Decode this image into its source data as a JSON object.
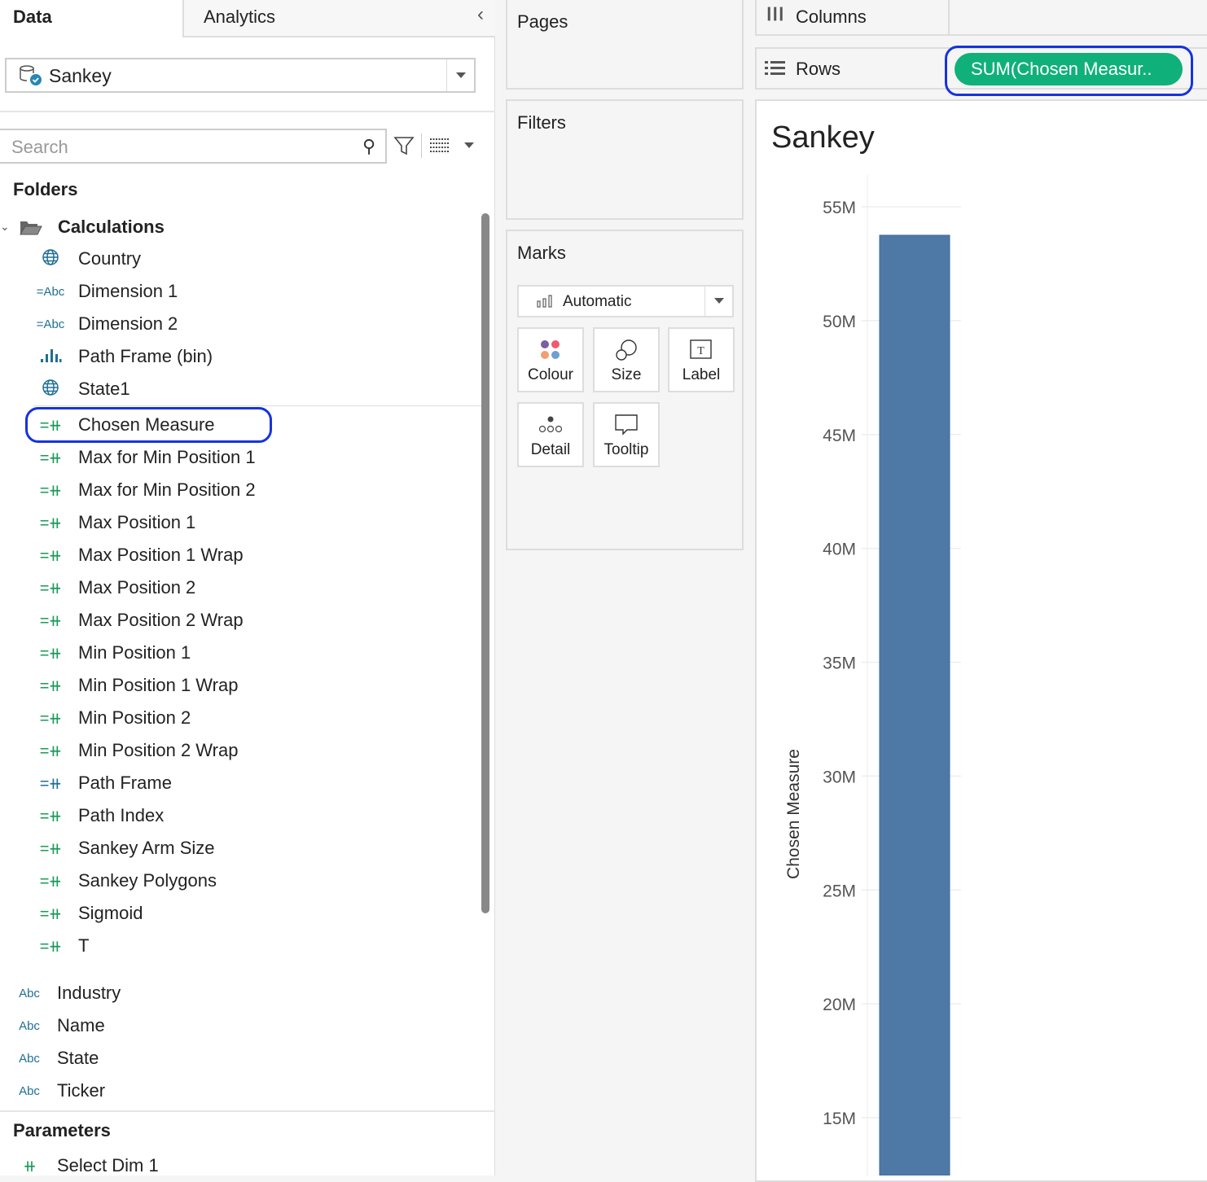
{
  "tabs": {
    "data": "Data",
    "analytics": "Analytics"
  },
  "datasource": {
    "name": "Sankey"
  },
  "search": {
    "placeholder": "Search"
  },
  "folders_header": "Folders",
  "folder": {
    "name": "Calculations"
  },
  "calc_fields": [
    {
      "label": "Country",
      "type": "geo"
    },
    {
      "label": "Dimension 1",
      "type": "calc-dim",
      "icon_text": "=Abc"
    },
    {
      "label": "Dimension 2",
      "type": "calc-dim",
      "icon_text": "=Abc"
    },
    {
      "label": "Path Frame (bin)",
      "type": "bin"
    },
    {
      "label": "State1",
      "type": "geo"
    },
    {
      "label": "Chosen Measure",
      "type": "calc-measure",
      "icon_text": "=#",
      "highlighted": true
    },
    {
      "label": "Max for Min Position 1",
      "type": "calc-measure",
      "icon_text": "=#"
    },
    {
      "label": "Max for Min Position 2",
      "type": "calc-measure",
      "icon_text": "=#"
    },
    {
      "label": "Max Position 1",
      "type": "calc-measure",
      "icon_text": "=#"
    },
    {
      "label": "Max Position 1 Wrap",
      "type": "calc-measure",
      "icon_text": "=#"
    },
    {
      "label": "Max Position 2",
      "type": "calc-measure",
      "icon_text": "=#"
    },
    {
      "label": "Max Position 2 Wrap",
      "type": "calc-measure",
      "icon_text": "=#"
    },
    {
      "label": "Min Position 1",
      "type": "calc-measure",
      "icon_text": "=#"
    },
    {
      "label": "Min Position 1 Wrap",
      "type": "calc-measure",
      "icon_text": "=#"
    },
    {
      "label": "Min Position 2",
      "type": "calc-measure",
      "icon_text": "=#"
    },
    {
      "label": "Min Position 2 Wrap",
      "type": "calc-measure",
      "icon_text": "=#"
    },
    {
      "label": "Path Frame",
      "type": "calc-dim-num",
      "icon_text": "=#"
    },
    {
      "label": "Path Index",
      "type": "calc-measure",
      "icon_text": "=#"
    },
    {
      "label": "Sankey Arm Size",
      "type": "calc-measure",
      "icon_text": "=#"
    },
    {
      "label": "Sankey Polygons",
      "type": "calc-measure",
      "icon_text": "=#"
    },
    {
      "label": "Sigmoid",
      "type": "calc-measure",
      "icon_text": "=#"
    },
    {
      "label": "T",
      "type": "calc-measure",
      "icon_text": "=#"
    }
  ],
  "dimensions": [
    {
      "label": "Industry",
      "icon_text": "Abc"
    },
    {
      "label": "Name",
      "icon_text": "Abc"
    },
    {
      "label": "State",
      "icon_text": "Abc"
    },
    {
      "label": "Ticker",
      "icon_text": "Abc"
    }
  ],
  "parameters_header": "Parameters",
  "parameters": [
    {
      "label": "Select Dim 1",
      "icon_text": "#"
    }
  ],
  "cards": {
    "pages": "Pages",
    "filters": "Filters",
    "marks": "Marks"
  },
  "marks": {
    "type": "Automatic",
    "buttons": {
      "colour": "Colour",
      "size": "Size",
      "label": "Label",
      "detail": "Detail",
      "tooltip": "Tooltip"
    }
  },
  "shelves": {
    "columns": "Columns",
    "rows": "Rows",
    "rows_pill": "SUM(Chosen Measur.."
  },
  "colors": {
    "measure": "#1a9a5a",
    "dimension": "#1f6f94",
    "pill": "#10b07a",
    "bar": "#4e79a7",
    "highlight": "#1533e0"
  },
  "chart_data": {
    "type": "bar",
    "title": "Sankey",
    "ylabel": "Chosen Measure",
    "ylim_visible": [
      13,
      56
    ],
    "yticks": [
      "55M",
      "50M",
      "45M",
      "40M",
      "35M",
      "30M",
      "25M",
      "20M",
      "15M"
    ],
    "ytick_values": [
      55000000,
      50000000,
      45000000,
      40000000,
      35000000,
      30000000,
      25000000,
      20000000,
      15000000
    ],
    "values": [
      53750000
    ],
    "grid": true
  }
}
